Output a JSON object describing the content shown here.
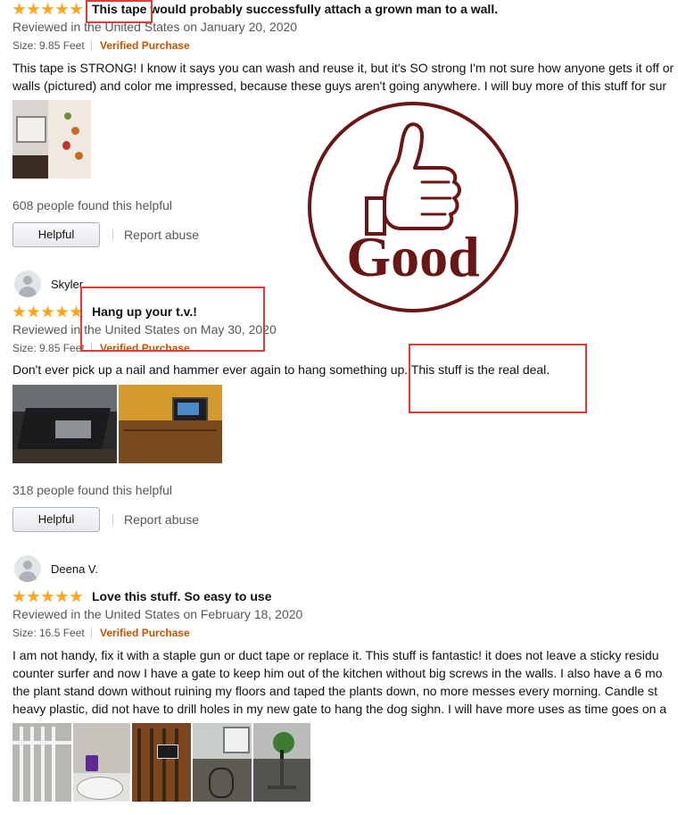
{
  "reviews": [
    {
      "title": "This tape would probably successfully attach a grown man to a wall.",
      "meta": "Reviewed in the United States on January 20, 2020",
      "size": "Size: 9.85 Feet",
      "verified": "Verified Purchase",
      "body_lines": [
        "This tape is STRONG! I know it says you can wash and reuse it, but it's SO strong I'm not sure how anyone gets it off or",
        "walls (pictured) and color me impressed, because these guys aren't going anywhere. I will buy more of this stuff for sur"
      ],
      "helpful_count": "608 people found this helpful",
      "helpful_label": "Helpful",
      "report_label": "Report abuse",
      "rating": 5
    },
    {
      "username": "Skyler",
      "title": "Hang up your t.v.!",
      "meta": "Reviewed in the United States on May 30, 2020",
      "size": "Size: 9.85 Feet",
      "verified": "Verified Purchase",
      "body_lines": [
        "Don't ever pick up a nail and hammer ever again to hang something up. This stuff is the real deal."
      ],
      "helpful_count": "318 people found this helpful",
      "helpful_label": "Helpful",
      "report_label": "Report abuse",
      "rating": 5
    },
    {
      "username": "Deena V.",
      "title": "Love this stuff. So easy to use",
      "meta": "Reviewed in the United States on February 18, 2020",
      "size": "Size: 16.5 Feet",
      "verified": "Verified Purchase",
      "body_lines": [
        "I am not handy, fix it with a staple gun or duct tape or replace it. This stuff is fantastic! it does not leave a sticky residu",
        "counter surfer and now I have a gate to keep him out of the kitchen without big screws in the walls. I also have a 6 mo",
        "the plant stand down without ruining my floors and taped the plants down, no more messes every morning. Candle st",
        "heavy plastic, did not have to drill holes in my new gate to hang the dog sighn. I will have more uses as time goes on a"
      ],
      "rating": 5
    }
  ],
  "stamp": {
    "text": "Good",
    "color": "#6b1616"
  },
  "colors": {
    "star": "#ffa41c",
    "verified": "#c45500",
    "highlight_box": "#e53935"
  }
}
